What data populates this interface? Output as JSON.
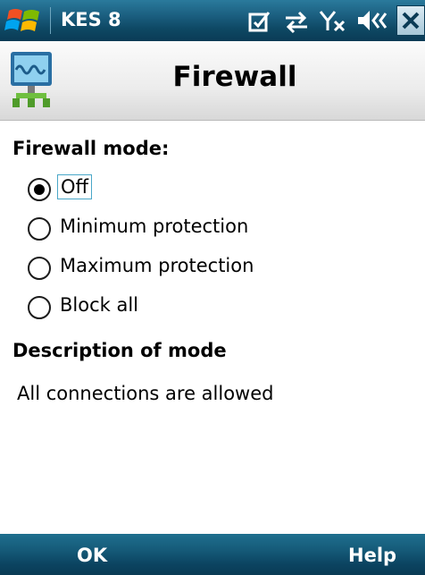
{
  "statusbar": {
    "app_name": "KES 8",
    "icons": [
      "windows-start-icon",
      "message-notification-icon",
      "connectivity-icon",
      "no-signal-icon",
      "speaker-icon",
      "close-icon"
    ]
  },
  "titlebar": {
    "icon": "firewall-icon",
    "title": "Firewall"
  },
  "main": {
    "mode_label": "Firewall mode:",
    "modes": [
      {
        "label": "Off",
        "selected": true
      },
      {
        "label": "Minimum protection",
        "selected": false
      },
      {
        "label": "Maximum protection",
        "selected": false
      },
      {
        "label": "Block all",
        "selected": false
      }
    ],
    "description_label": "Description of mode",
    "description": "All connections are allowed"
  },
  "softkeys": {
    "left": "OK",
    "right": "Help"
  }
}
